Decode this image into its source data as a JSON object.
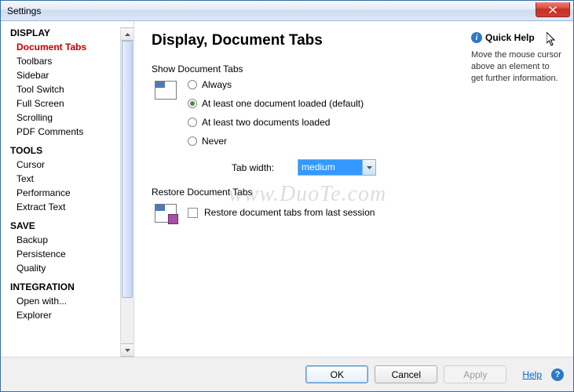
{
  "window": {
    "title": "Settings"
  },
  "sidebar": {
    "categories": [
      {
        "label": "DISPLAY",
        "items": [
          {
            "label": "Document Tabs",
            "selected": true
          },
          {
            "label": "Toolbars"
          },
          {
            "label": "Sidebar"
          },
          {
            "label": "Tool Switch"
          },
          {
            "label": "Full Screen"
          },
          {
            "label": "Scrolling"
          },
          {
            "label": "PDF Comments"
          }
        ]
      },
      {
        "label": "TOOLS",
        "items": [
          {
            "label": "Cursor"
          },
          {
            "label": "Text"
          },
          {
            "label": "Performance"
          },
          {
            "label": "Extract Text"
          }
        ]
      },
      {
        "label": "SAVE",
        "items": [
          {
            "label": "Backup"
          },
          {
            "label": "Persistence"
          },
          {
            "label": "Quality"
          }
        ]
      },
      {
        "label": "INTEGRATION",
        "items": [
          {
            "label": "Open with..."
          },
          {
            "label": "Explorer"
          }
        ]
      }
    ]
  },
  "main": {
    "heading": "Display, Document Tabs",
    "show_section": {
      "label": "Show Document Tabs",
      "options": [
        {
          "label": "Always"
        },
        {
          "label": "At least one document loaded (default)",
          "checked": true
        },
        {
          "label": "At least two documents loaded"
        },
        {
          "label": "Never"
        }
      ],
      "tab_width_label": "Tab width:",
      "tab_width_value": "medium"
    },
    "restore_section": {
      "label": "Restore Document Tabs",
      "checkbox_label": "Restore document tabs from last session"
    }
  },
  "quickhelp": {
    "title": "Quick Help",
    "text": "Move the mouse cursor above an element to get further information."
  },
  "footer": {
    "ok": "OK",
    "cancel": "Cancel",
    "apply": "Apply",
    "help": "Help"
  },
  "watermark": "www.DuoTe.com"
}
